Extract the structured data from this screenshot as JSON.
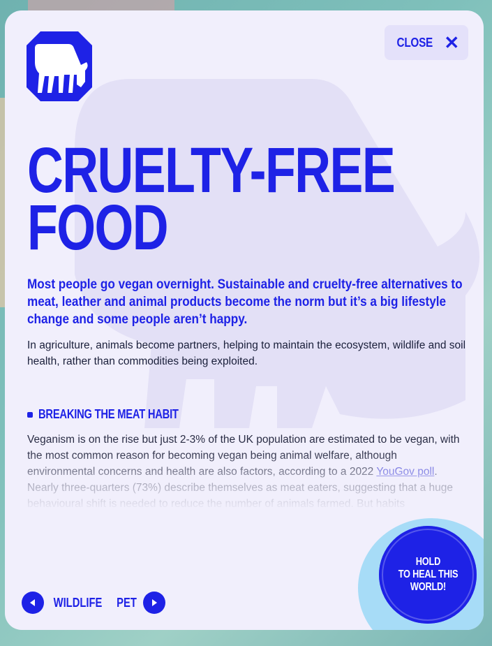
{
  "modal": {
    "close_label": "CLOSE",
    "title_line1": "CRUELTY-FREE",
    "title_line2": "FOOD",
    "lead": "Most people go vegan overnight. Sustainable and cruelty-free alternatives to meat, leather and animal products become the norm but it’s a big lifestyle change and some people aren’t happy.",
    "intro": "In agriculture, animals become partners, helping to maintain the ecosystem, wildlife and soil health, rather than commodities being exploited.",
    "section": {
      "title": "BREAKING THE MEAT HABIT",
      "body_before_link": "Veganism is on the rise but just 2-3% of the UK population are estimated to be vegan, with the most common reason for becoming vegan being animal welfare, although environmental concerns and health are also factors, according to a 2022 ",
      "link_text": "YouGov poll",
      "body_after_link": ". Nearly three-quarters (73%) describe themselves as meat eaters, suggesting that a huge behavioural shift is needed to reduce the number of animals farmed. But habits"
    },
    "nav": {
      "prev_label": "WILDLIFE",
      "next_label": "PET"
    },
    "hold_button": "HOLD\nTO HEAL THIS\nWORLD!"
  },
  "colors": {
    "accent": "#1e22e6",
    "modal_bg": "#f1effc",
    "watermark": "#e3e0f6"
  },
  "icons": {
    "close": "close-icon",
    "logo": "cow-logo-icon",
    "prev": "arrow-left-icon",
    "next": "arrow-right-icon"
  }
}
